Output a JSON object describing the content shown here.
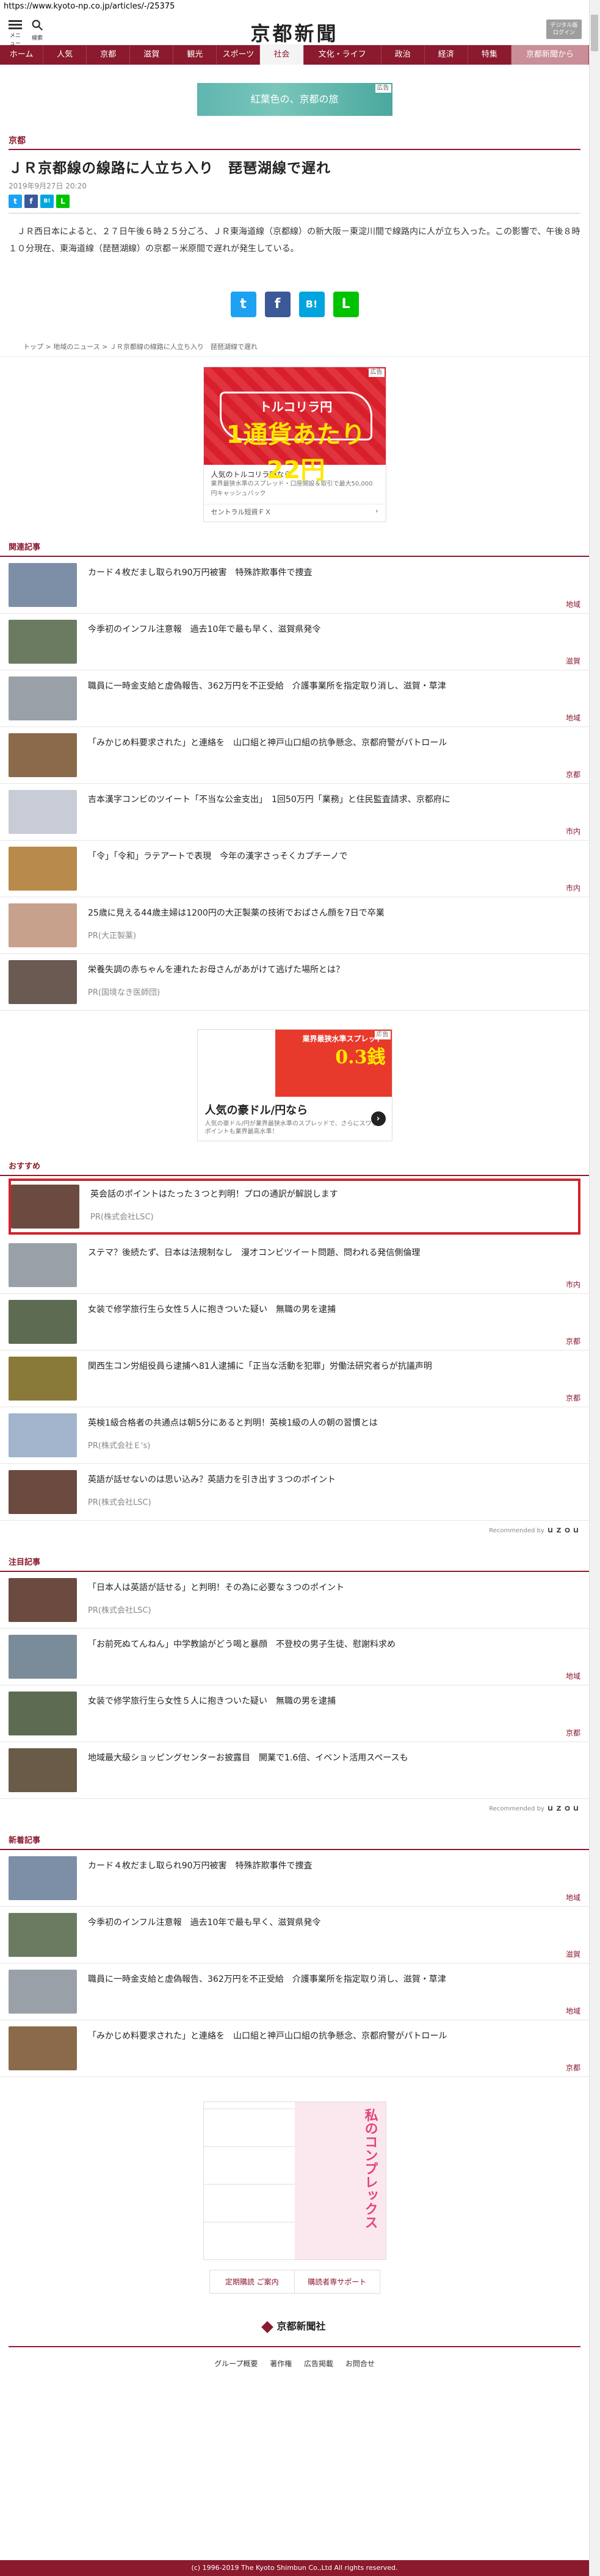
{
  "browser": {
    "url": "https://www.kyoto-np.co.jp/articles/-/25375"
  },
  "header": {
    "menu_label": "メニュー",
    "search_label": "検索",
    "logo": "京都新聞",
    "digital_btn_line1": "デジタル版",
    "digital_btn_line2": "ログイン"
  },
  "nav": [
    "ホーム",
    "人気",
    "京都",
    "滋賀",
    "観光",
    "スポーツ",
    "社会",
    "文化・ライフ",
    "政治",
    "経済",
    "特集",
    "京都新聞から"
  ],
  "banner1": {
    "text": "紅葉色の、京都の旅",
    "ad_label": "広告"
  },
  "article": {
    "section": "京都",
    "title": "ＪＲ京都線の線路に人立ち入り　琵琶湖線で遅れ",
    "date": "2019年9月27日 20:20",
    "body": "ＪＲ西日本によると、２７日午後６時２５分ごろ、ＪＲ東海道線（京都線）の新大阪－東淀川間で線路内に人が立ち入った。この影響で、午後８時１０分現在、東海道線（琵琶湖線）の京都－米原間で遅れが発生している。",
    "share_small": [
      "t",
      "f",
      "B!",
      "L"
    ],
    "share_big": [
      "t",
      "f",
      "B!",
      "L"
    ]
  },
  "breadcrumb": [
    "トップ",
    "地域のニュース",
    "ＪＲ京都線の線路に人立ち入り　琵琶湖線で遅れ"
  ],
  "ad1": {
    "ad_label": "広告",
    "headline_top": "トルコリラ円",
    "headline_num": "1通貨あたり22円",
    "text": "人気のトルコリラ円なら",
    "small": "業界最狭水準のスプレッド・口座開設＆取引で最大50,000円キャッシュバック",
    "sponsor": "セントラル短資ＦＸ",
    "sponsor_link": "›"
  },
  "related": {
    "label": "関連記事",
    "items": [
      {
        "title": "カード４枚だまし取られ90万円被害　特殊詐欺事件で捜査",
        "cat": "地域",
        "pr": "",
        "color": "#7d8fa6"
      },
      {
        "title": "今季初のインフル注意報　過去10年で最も早く、滋賀県発令",
        "cat": "滋賀",
        "pr": "",
        "color": "#6b7b62"
      },
      {
        "title": "職員に一時金支給と虚偽報告、362万円を不正受給　介護事業所を指定取り消し、滋賀・草津",
        "cat": "地域",
        "pr": "",
        "color": "#9aa0a8"
      },
      {
        "title": "「みかじめ料要求された」と連絡を　山口組と神戸山口組の抗争懸念、京都府警がパトロール",
        "cat": "京都",
        "pr": "",
        "color": "#8a6a4a"
      },
      {
        "title": "吉本漢字コンビのツイート「不当な公金支出」　1回50万円「業務」と住民監査請求、京都府に",
        "cat": "市内",
        "pr": "",
        "color": "#c8ccd6"
      },
      {
        "title": "「令」「令和」ラテアートで表現　今年の漢字さっそくカプチーノで",
        "cat": "市内",
        "pr": "",
        "color": "#b88a4c"
      },
      {
        "title": "25歳に見える44歳主婦は1200円の大正製薬の技術でおばさん顔を7日で卒業",
        "cat": "",
        "pr": "PR(大正製薬)",
        "color": "#c7a18c"
      },
      {
        "title": "栄養失調の赤ちゃんを連れたお母さんがあがけて逃げた場所とは？",
        "cat": "",
        "pr": "PR(国境なき医師団)",
        "color": "#6a5a52"
      }
    ]
  },
  "ad2": {
    "ad_label": "広告",
    "headline": "業界最狭水準スプレッド",
    "rate": "0.3銭",
    "title": "人気の豪ドル/円なら",
    "small": "人気の豪ドル/円が業界最狭水準のスプレッドで、さらにスワップポイントも業界最高水準！"
  },
  "recommend": {
    "label": "おすすめ",
    "items": [
      {
        "title": "英会話のポイントはたった３つと判明！プロの通訳が解説します",
        "cat": "",
        "pr": "PR(株式会社LSC)",
        "color": "#6b4a40",
        "highlight": true
      },
      {
        "title": "ステマ？後続たず、日本は法規制なし　漫才コンビツイート問題、問われる発信側倫理",
        "cat": "市内",
        "pr": "",
        "color": "#9aa0a8",
        "highlight": false
      },
      {
        "title": "女装で修学旅行生ら女性５人に抱きついた疑い　無職の男を逮捕",
        "cat": "京都",
        "pr": "",
        "color": "#5d6b52",
        "highlight": false
      },
      {
        "title": "関西生コン労組役員ら逮捕へ81人逮捕に「正当な活動を犯罪」労働法研究者らが抗議声明",
        "cat": "京都",
        "pr": "",
        "color": "#8a7a3a",
        "highlight": false
      },
      {
        "title": "英検1級合格者の共通点は朝5分にあると判明！英検1級の人の朝の習慣とは",
        "cat": "",
        "pr": "PR(株式会社Ｅ's)",
        "color": "#a2b4cc",
        "highlight": false
      },
      {
        "title": "英語が話せないのは思い込み？英語力を引き出す３つのポイント",
        "cat": "",
        "pr": "PR(株式会社LSC)",
        "color": "#6b4a40",
        "highlight": false
      }
    ],
    "recommended_by": "Recommended by",
    "brand": "ｕｚｏｕ"
  },
  "attention": {
    "label": "注目記事",
    "items": [
      {
        "title": "「日本人は英語が話せる」と判明！その為に必要な３つのポイント",
        "cat": "",
        "pr": "PR(株式会社LSC)",
        "color": "#6b4a40"
      },
      {
        "title": "「お前死ぬてんねん」中学教諭がどう喝と暴顔　不登校の男子生徒、慰謝料求め",
        "cat": "地域",
        "pr": "",
        "color": "#7a8c9a"
      },
      {
        "title": "女装で修学旅行生ら女性５人に抱きついた疑い　無職の男を逮捕",
        "cat": "京都",
        "pr": "",
        "color": "#5d6b52"
      },
      {
        "title": "地域最大級ショッピングセンターお披露目　開業で1.6倍、イベント活用スペースも",
        "cat": "",
        "pr": "",
        "color": "#6a5a48"
      }
    ],
    "recommended_by": "Recommended by",
    "brand": "ｕｚｏｕ"
  },
  "latest": {
    "label": "新着記事",
    "items": [
      {
        "title": "カード４枚だまし取られ90万円被害　特殊詐欺事件で捜査",
        "cat": "地域",
        "color": "#7d8fa6"
      },
      {
        "title": "今季初のインフル注意報　過去10年で最も早く、滋賀県発令",
        "cat": "滋賀",
        "color": "#6b7b62"
      },
      {
        "title": "職員に一時金支給と虚偽報告、362万円を不正受給　介護事業所を指定取り消し、滋賀・草津",
        "cat": "地域",
        "color": "#9aa0a8"
      },
      {
        "title": "「みかじめ料要求された」と連絡を　山口組と神戸山口組の抗争懸念、京都府警がパトロール",
        "cat": "京都",
        "color": "#8a6a4a"
      }
    ]
  },
  "manga_ad": {
    "text": "私のコンプレックス"
  },
  "footer": {
    "links": [
      "定期購読 ご案内",
      "購読者専サポート"
    ],
    "logo": "京都新聞社",
    "nav": [
      "グループ概要",
      "著作権",
      "広告掲載",
      "お問合せ"
    ],
    "copyright": "(c) 1996-2019 The Kyoto Shimbun Co.,Ltd All rights reserved."
  }
}
